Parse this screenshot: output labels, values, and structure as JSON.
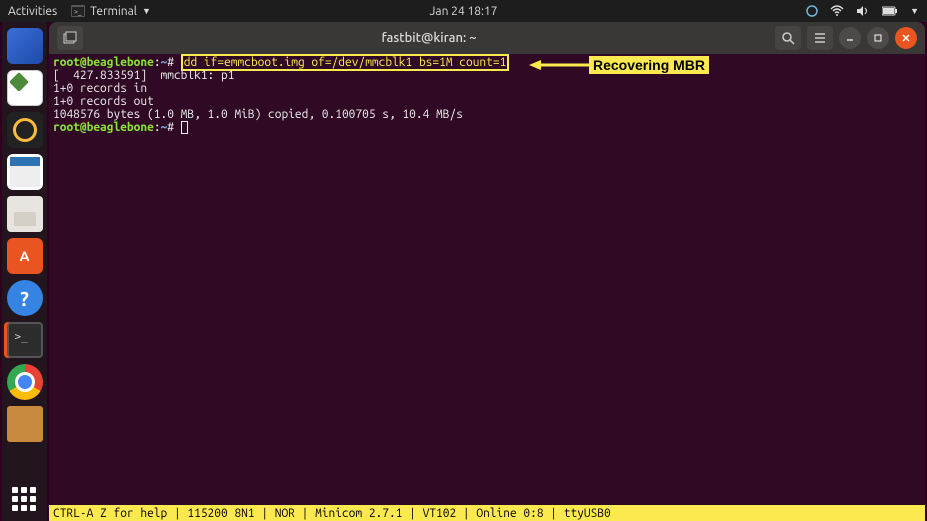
{
  "topbar": {
    "activities": "Activities",
    "app_menu": "Terminal",
    "clock": "Jan 24  18:17"
  },
  "dock": {
    "items": [
      "thunderbird",
      "text-editor",
      "rhythmbox",
      "libreoffice-writer",
      "files",
      "software",
      "help",
      "terminal",
      "chrome",
      "pictures-folder"
    ]
  },
  "window": {
    "title": "fastbit@kiran: ~"
  },
  "terminal": {
    "prompt_user_host": "root@beaglebone",
    "prompt_path": "~",
    "prompt_suffix": "#",
    "highlighted_command": "dd if=emmcboot.img of=/dev/mmcblk1 bs=1M count=1",
    "line2": "[  427.833591]  mmcblk1: p1",
    "line3": "1+0 records in",
    "line4": "1+0 records out",
    "line5": "1048576 bytes (1.0 MB, 1.0 MiB) copied, 0.100705 s, 10.4 MB/s"
  },
  "annotation": {
    "label": "Recovering MBR"
  },
  "statusbar": {
    "text": "CTRL-A Z for help | 115200 8N1 | NOR | Minicom 2.7.1 | VT102 | Online 0:8 | ttyUSB0"
  }
}
